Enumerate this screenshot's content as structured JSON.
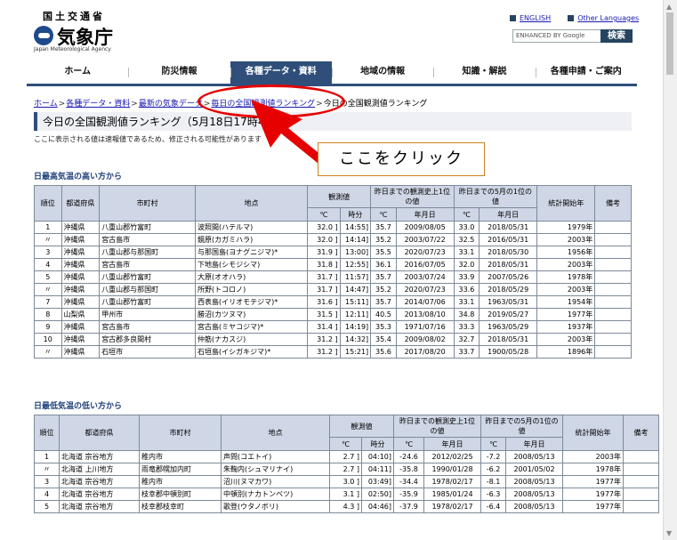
{
  "header": {
    "org_top": "国土交通省",
    "org_name": "気象庁",
    "org_en": "Japan Meteorological Agency",
    "english_link": "ENGLISH",
    "other_lang_link": "Other Languages",
    "search_placeholder": "ENHANCED BY Google",
    "search_button": "検索"
  },
  "nav": [
    "ホーム",
    "防災情報",
    "各種データ・資料",
    "地域の情報",
    "知識・解説",
    "各種申請・ご案内"
  ],
  "breadcrumb": [
    "ホーム",
    "各種データ・資料",
    "最新の気象データ",
    "毎日の全国観測値ランキング",
    "今日の全国観測値ランキング"
  ],
  "page": {
    "title": "今日の全国観測値ランキング（5月18日17時40分",
    "note": "ここに表示される値は速報値であるため、修正される可能性があります",
    "callout": "ここをクリック"
  },
  "high": {
    "section": "日最高気温の高い方から",
    "head": {
      "rank": "順位",
      "pref": "都道府県",
      "city": "市町村",
      "station": "地点",
      "obs": "観測値",
      "hist": "昨日までの観測史上1位の値",
      "may": "昨日までの5月の1位の値",
      "start": "統計開始年",
      "remarks": "備考",
      "deg": "℃",
      "time": "時分",
      "date": "年月日"
    },
    "rows": [
      [
        "1",
        "沖縄県",
        "八重山郡竹富町",
        "波照間(ハテルマ)",
        "32.0 ]",
        "14:55]",
        "35.7",
        "2009/08/05",
        "33.0",
        "2018/05/31",
        "1979年",
        ""
      ],
      [
        "〃",
        "沖縄県",
        "宮古島市",
        "鏡原(カガミハラ)",
        "32.0 ]",
        "14:14]",
        "35.2",
        "2003/07/22",
        "32.5",
        "2016/05/31",
        "2003年",
        ""
      ],
      [
        "3",
        "沖縄県",
        "八重山郡与那国町",
        "与那国島(ヨナグニジマ)*",
        "31.9 ]",
        "13:00]",
        "35.5",
        "2020/07/23",
        "33.1",
        "2018/05/30",
        "1956年",
        ""
      ],
      [
        "4",
        "沖縄県",
        "宮古島市",
        "下地島(シモジシマ)",
        "31.8 ]",
        "12:55]",
        "36.1",
        "2016/07/05",
        "32.0",
        "2018/05/31",
        "2003年",
        ""
      ],
      [
        "5",
        "沖縄県",
        "八重山郡竹富町",
        "大原(オオハラ)",
        "31.7 ]",
        "11:57]",
        "35.7",
        "2003/07/24",
        "33.9",
        "2007/05/26",
        "1978年",
        ""
      ],
      [
        "〃",
        "沖縄県",
        "八重山郡与那国町",
        "所野(トコロノ)",
        "31.7 ]",
        "14:47]",
        "35.2",
        "2020/07/23",
        "33.6",
        "2018/05/29",
        "2003年",
        ""
      ],
      [
        "7",
        "沖縄県",
        "八重山郡竹富町",
        "西表島(イリオモテジマ)*",
        "31.6 ]",
        "15:11]",
        "35.7",
        "2014/07/06",
        "33.1",
        "1963/05/31",
        "1954年",
        ""
      ],
      [
        "8",
        "山梨県",
        "甲州市",
        "勝沼(カツヌマ)",
        "31.5 ]",
        "12:11]",
        "40.5",
        "2013/08/10",
        "34.8",
        "2019/05/27",
        "1977年",
        ""
      ],
      [
        "9",
        "沖縄県",
        "宮古島市",
        "宮古島(ミヤコジマ)*",
        "31.4 ]",
        "14:19]",
        "35.3",
        "1971/07/16",
        "33.3",
        "1963/05/29",
        "1937年",
        ""
      ],
      [
        "10",
        "沖縄県",
        "宮古郡多良間村",
        "仲筋(ナカスジ)",
        "31.2 ]",
        "14:32]",
        "35.4",
        "2009/08/02",
        "32.7",
        "2018/05/31",
        "2003年",
        ""
      ],
      [
        "〃",
        "沖縄県",
        "石垣市",
        "石垣島(イシガキジマ)*",
        "31.2 ]",
        "15:21]",
        "35.6",
        "2017/08/20",
        "33.7",
        "1900/05/28",
        "1896年",
        ""
      ]
    ]
  },
  "low": {
    "section": "日最低気温の低い方から",
    "head": {
      "rank": "順位",
      "pref": "都道府県",
      "city": "市町村",
      "station": "地点",
      "obs": "観測値",
      "hist": "昨日までの観測史上1位の値",
      "may": "昨日までの5月の1位の値",
      "start": "統計開始年",
      "remarks": "備考",
      "deg": "℃",
      "time": "時分",
      "date": "年月日"
    },
    "rows": [
      [
        "1",
        "北海道 宗谷地方",
        "稚内市",
        "声問(コエトイ)",
        "2.7 ]",
        "04:10]",
        "-24.6",
        "2012/02/25",
        "-7.2",
        "2008/05/13",
        "2003年",
        ""
      ],
      [
        "〃",
        "北海道 上川地方",
        "雨竜郡幌加内町",
        "朱鞠内(シュマリナイ)",
        "2.7 ]",
        "04:11]",
        "-35.8",
        "1990/01/28",
        "-6.2",
        "2001/05/02",
        "1978年",
        ""
      ],
      [
        "3",
        "北海道 宗谷地方",
        "稚内市",
        "沼川(ヌマカワ)",
        "3.0 ]",
        "03:49]",
        "-34.4",
        "1978/02/17",
        "-8.1",
        "2008/05/13",
        "1977年",
        ""
      ],
      [
        "4",
        "北海道 宗谷地方",
        "枝幸郡中頓別町",
        "中頓別(ナカトンベツ)",
        "3.1 ]",
        "02:50]",
        "-35.9",
        "1985/01/24",
        "-6.3",
        "2008/05/13",
        "1977年",
        ""
      ],
      [
        "5",
        "北海道 宗谷地方",
        "枝幸郡枝幸町",
        "歌登(ウタノボリ)",
        "4.3 ]",
        "04:46]",
        "-37.9",
        "1978/02/17",
        "-6.4",
        "2008/05/13",
        "1977年",
        ""
      ]
    ]
  }
}
